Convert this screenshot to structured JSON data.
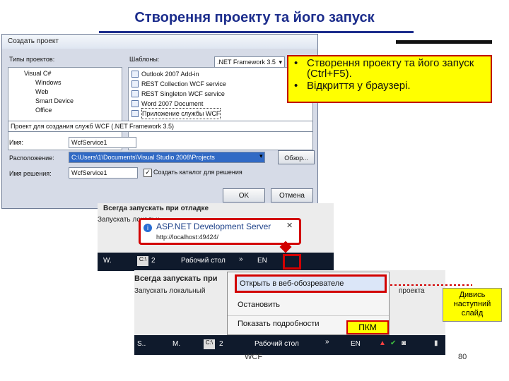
{
  "slide": {
    "title": "Створення проекту та його запуск",
    "bullets": [
      "Створення проекту та його запуск (Ctrl+F5).",
      "Відкриття у браузері."
    ],
    "note": "Дивись наступний слайд",
    "pkm": "ПКМ",
    "footer_left": "WCF",
    "page_number": "80"
  },
  "dialog": {
    "title": "Создать проект",
    "project_types_label": "Типы проектов:",
    "templates_label": "Шаблоны:",
    "framework": ".NET Framework 3.5",
    "project_types": [
      "Visual C#",
      "Windows",
      "Web",
      "Smart Device",
      "Office"
    ],
    "templates": [
      "Outlook 2007 Add-in",
      "REST Collection WCF service",
      "REST Singleton WCF service",
      "Word 2007 Document",
      "Приложение службы WCF"
    ],
    "description": "Проект для создания служб WCF (.NET Framework 3.5)",
    "name_label": "Имя:",
    "name_value": "WcfService1",
    "location_label": "Расположение:",
    "location_value": "C:\\Users\\1\\Documents\\Visual Studio 2008\\Projects",
    "browse_label": "Обзор...",
    "solution_label": "Имя решения:",
    "solution_value": "WcfService1",
    "create_dir_label": "Создать каталог для решения",
    "ok_label": "OK",
    "cancel_label": "Отмена"
  },
  "shot2": {
    "always_label": "Всегда запускать при отладке",
    "run_local": "Запускать локальн",
    "tip_title": "ASP.NET Development Server",
    "tip_url": "http://localhost:49424/",
    "tb_w": "W.",
    "tb_count": "2",
    "tb_desktop": "Рабочий стол",
    "tb_lang": "EN"
  },
  "shot3": {
    "always_label": "Всегда запускать при",
    "run_local": "Запускать локальный",
    "project_tail": "проекта",
    "menu": [
      "Открыть в веб-обозревателе",
      "Остановить",
      "Показать подробности"
    ],
    "tb_s": "S..",
    "tb_m": "M.",
    "tb_count": "2",
    "tb_desktop": "Рабочий стол",
    "tb_lang": "EN"
  }
}
